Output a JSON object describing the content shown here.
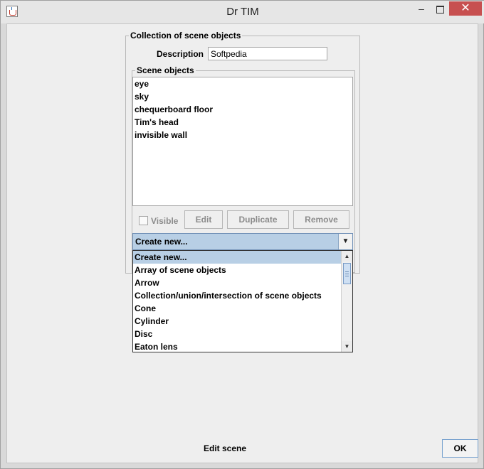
{
  "window": {
    "title": "Dr TIM",
    "minimize_glyph": "–",
    "close_glyph": "✕"
  },
  "collection": {
    "group_title": "Collection of scene objects",
    "description_label": "Description",
    "description_value": "Softpedia"
  },
  "scene_objects": {
    "group_title": "Scene objects",
    "items": [
      "eye",
      "sky",
      "chequerboard floor",
      "Tim's head",
      "invisible wall"
    ],
    "visible_label": "Visible",
    "visible_checked": false,
    "edit_label": "Edit",
    "duplicate_label": "Duplicate",
    "remove_label": "Remove"
  },
  "create_new": {
    "selected": "Create new...",
    "arrow": "▼",
    "options": [
      "Create new...",
      "Array of scene objects",
      "Arrow",
      "Collection/union/intersection of scene objects",
      "Cone",
      "Cylinder",
      "Disc",
      "Eaton lens"
    ]
  },
  "footer": {
    "status": "Edit scene",
    "ok_label": "OK"
  }
}
